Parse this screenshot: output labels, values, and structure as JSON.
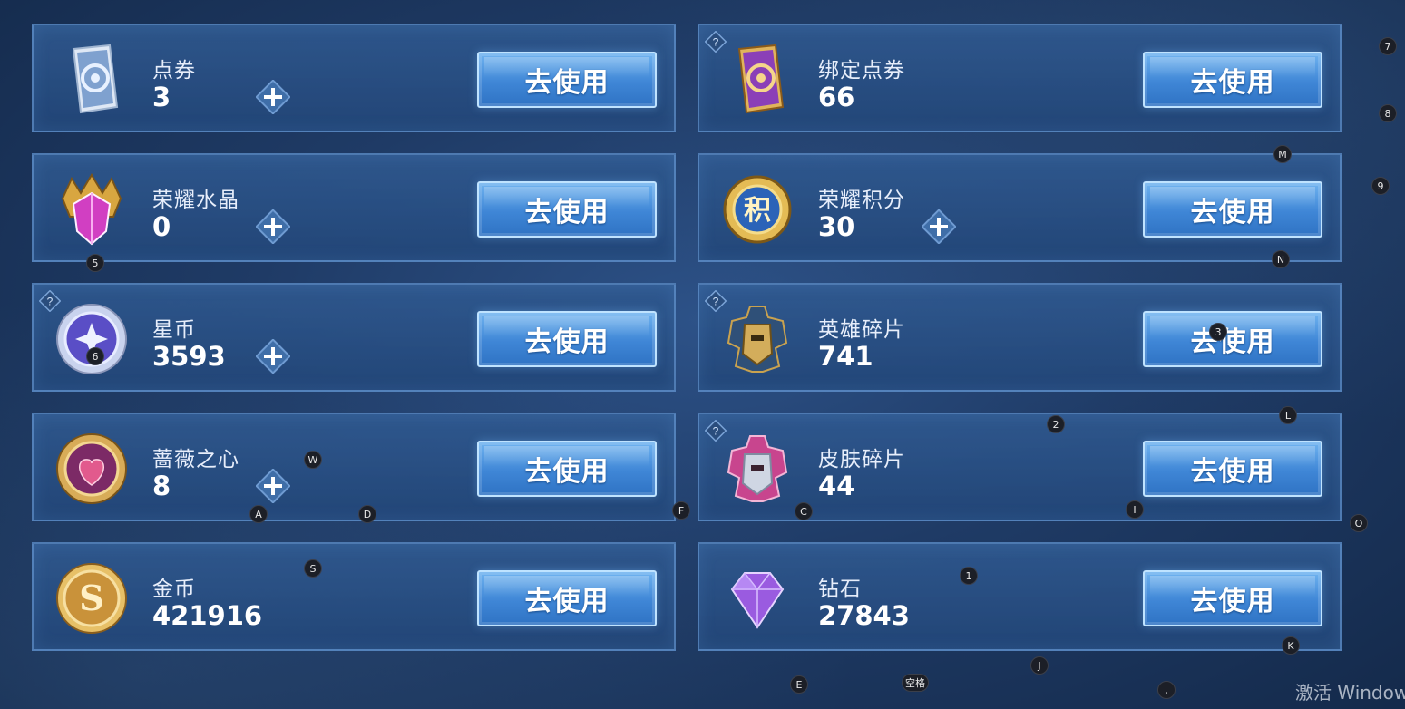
{
  "use_label": "去使用",
  "currencies": [
    {
      "label": "点券",
      "value": "3"
    },
    {
      "label": "绑定点券",
      "value": "66"
    },
    {
      "label": "荣耀水晶",
      "value": "0"
    },
    {
      "label": "荣耀积分",
      "value": "30"
    },
    {
      "label": "星币",
      "value": "3593"
    },
    {
      "label": "英雄碎片",
      "value": "741"
    },
    {
      "label": "蔷薇之心",
      "value": "8"
    },
    {
      "label": "皮肤碎片",
      "value": "44"
    },
    {
      "label": "金币",
      "value": "421916"
    },
    {
      "label": "钻石",
      "value": "27843"
    }
  ],
  "icons": {
    "coupon": "coupon-card-icon",
    "bound_coupon": "bound-coupon-card-icon",
    "crystal": "glory-crystal-icon",
    "points": "glory-points-icon",
    "star": "star-coin-icon",
    "hero": "hero-fragment-icon",
    "rose": "rose-heart-icon",
    "skin": "skin-fragment-icon",
    "gold": "gold-coin-icon",
    "diamond": "diamond-icon"
  },
  "hotkeys": [
    "7",
    "8",
    "9",
    "M",
    "5",
    "N",
    "6",
    "3",
    "2",
    "L",
    "W",
    "A",
    "D",
    "F",
    "C",
    "I",
    "O",
    "S",
    "1",
    "K",
    "J",
    "E",
    "空格",
    ","
  ],
  "watermark": "激活 Window"
}
